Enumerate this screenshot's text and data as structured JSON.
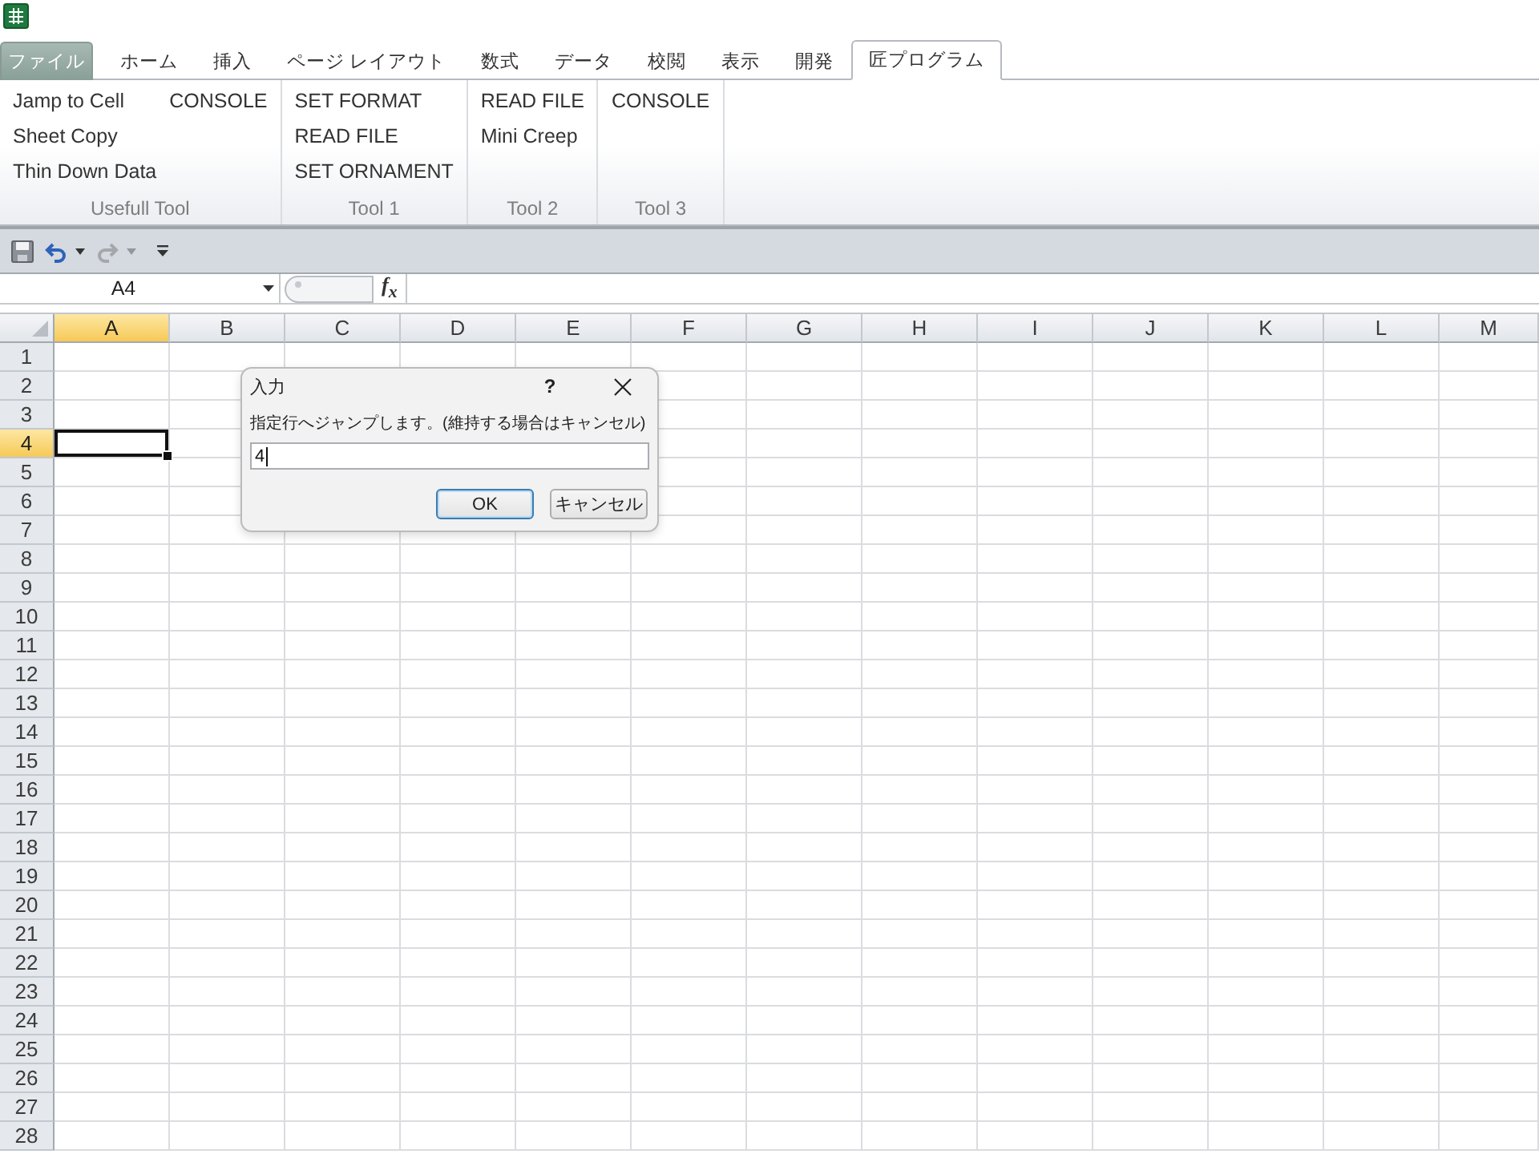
{
  "ribbon_tabs": [
    {
      "label": "ファイル",
      "kind": "file",
      "selected": false
    },
    {
      "label": "ホーム",
      "kind": "tab",
      "selected": false
    },
    {
      "label": "挿入",
      "kind": "tab",
      "selected": false
    },
    {
      "label": "ページ レイアウト",
      "kind": "tab",
      "selected": false
    },
    {
      "label": "数式",
      "kind": "tab",
      "selected": false
    },
    {
      "label": "データ",
      "kind": "tab",
      "selected": false
    },
    {
      "label": "校閲",
      "kind": "tab",
      "selected": false
    },
    {
      "label": "表示",
      "kind": "tab",
      "selected": false
    },
    {
      "label": "開発",
      "kind": "tab",
      "selected": false
    },
    {
      "label": "匠プログラム",
      "kind": "tab",
      "selected": true
    }
  ],
  "ribbon_groups": [
    {
      "label": "Usefull Tool",
      "columns": [
        [
          "Jamp to Cell",
          "Sheet Copy",
          "Thin Down Data"
        ],
        [
          "CONSOLE"
        ]
      ]
    },
    {
      "label": "Tool 1",
      "columns": [
        [
          "SET FORMAT",
          "READ FILE",
          "SET ORNAMENT"
        ]
      ]
    },
    {
      "label": "Tool 2",
      "columns": [
        [
          "READ FILE",
          "Mini Creep"
        ]
      ]
    },
    {
      "label": "Tool 3",
      "columns": [
        [
          "CONSOLE"
        ]
      ]
    }
  ],
  "quick_access": [
    {
      "kind": "save",
      "disabled": false
    },
    {
      "kind": "undo",
      "disabled": false
    },
    {
      "kind": "redo",
      "disabled": true
    },
    {
      "kind": "customize",
      "disabled": false
    }
  ],
  "formula_bar": {
    "name_box": "A4",
    "function_button": "f$_{x}$"
  },
  "sheet": {
    "columns": [
      {
        "label": "A",
        "selected": true
      },
      {
        "label": "B",
        "selected": false
      },
      {
        "label": "C",
        "selected": false
      },
      {
        "label": "D",
        "selected": false
      },
      {
        "label": "E",
        "selected": false
      },
      {
        "label": "F",
        "selected": false
      },
      {
        "label": "G",
        "selected": false
      },
      {
        "label": "H",
        "selected": false
      },
      {
        "label": "I",
        "selected": false
      },
      {
        "label": "J",
        "selected": false
      },
      {
        "label": "K",
        "selected": false
      },
      {
        "label": "L",
        "selected": false
      },
      {
        "label": "M",
        "selected": false
      }
    ],
    "rows": [
      {
        "label": "1",
        "selected": false
      },
      {
        "label": "2",
        "selected": false
      },
      {
        "label": "3",
        "selected": false
      },
      {
        "label": "4",
        "selected": true
      },
      {
        "label": "5",
        "selected": false
      },
      {
        "label": "6",
        "selected": false
      },
      {
        "label": "7",
        "selected": false
      },
      {
        "label": "8",
        "selected": false
      },
      {
        "label": "9",
        "selected": false
      },
      {
        "label": "10",
        "selected": false
      },
      {
        "label": "11",
        "selected": false
      },
      {
        "label": "12",
        "selected": false
      },
      {
        "label": "13",
        "selected": false
      },
      {
        "label": "14",
        "selected": false
      },
      {
        "label": "15",
        "selected": false
      },
      {
        "label": "16",
        "selected": false
      },
      {
        "label": "17",
        "selected": false
      },
      {
        "label": "18",
        "selected": false
      },
      {
        "label": "19",
        "selected": false
      },
      {
        "label": "20",
        "selected": false
      },
      {
        "label": "21",
        "selected": false
      },
      {
        "label": "22",
        "selected": false
      },
      {
        "label": "23",
        "selected": false
      },
      {
        "label": "24",
        "selected": false
      },
      {
        "label": "25",
        "selected": false
      },
      {
        "label": "26",
        "selected": false
      },
      {
        "label": "27",
        "selected": false
      },
      {
        "label": "28",
        "selected": false
      }
    ]
  },
  "dialog": {
    "title": "入力",
    "help": "?",
    "message": "指定行へジャンプします。(維持する場合はキャンセル)",
    "input": {
      "value": "4"
    },
    "buttons": [
      {
        "label": "OK",
        "default": true
      },
      {
        "label": "キャンセル",
        "default": false
      }
    ]
  }
}
